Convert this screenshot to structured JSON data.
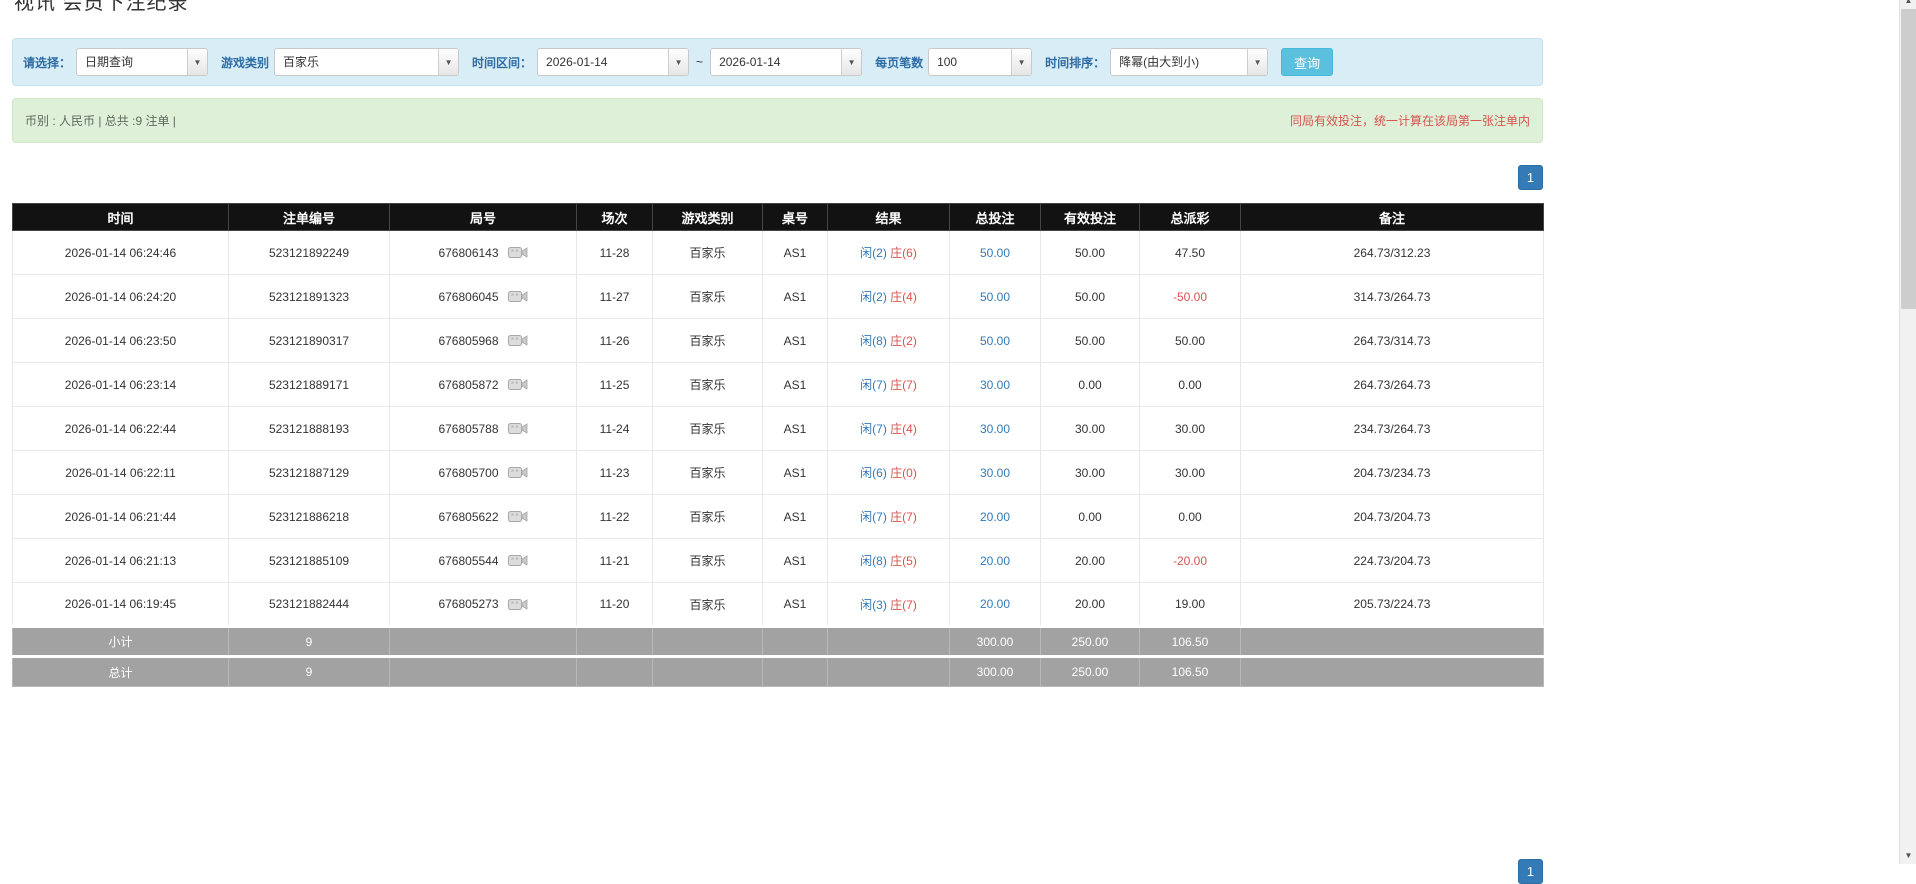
{
  "page": {
    "title": "视讯 会员下注纪录"
  },
  "filters": {
    "select_label": "请选择：",
    "select_value": "日期查询",
    "game_label": "游戏类别",
    "game_value": "百家乐",
    "range_label": "时间区间：",
    "date_from": "2026-01-14",
    "range_separator": "~",
    "date_to": "2026-01-14",
    "page_size_label": "每页笔数",
    "page_size_value": "100",
    "sort_label": "时间排序：",
    "sort_value": "降幂(由大到小)",
    "search_label": "查询"
  },
  "summary": {
    "left": "币别 : 人民币 | 总共 :9 注单 |",
    "right": "同局有效投注，统一计算在该局第一张注单内"
  },
  "pagination": {
    "current_page": "1"
  },
  "table": {
    "headers": [
      "时间",
      "注单编号",
      "局号",
      "场次",
      "游戏类别",
      "桌号",
      "结果",
      "总投注",
      "有效投注",
      "总派彩",
      "备注"
    ],
    "rows": [
      {
        "time": "2026-01-14 06:24:46",
        "bet_id": "523121892249",
        "round_id": "676806143",
        "session": "11-28",
        "game": "百家乐",
        "table_no": "AS1",
        "result_player": "闲(2)",
        "result_banker": "庄(6)",
        "total_bet": "50.00",
        "valid_bet": "50.00",
        "payout": "47.50",
        "note": "264.73/312.23"
      },
      {
        "time": "2026-01-14 06:24:20",
        "bet_id": "523121891323",
        "round_id": "676806045",
        "session": "11-27",
        "game": "百家乐",
        "table_no": "AS1",
        "result_player": "闲(2)",
        "result_banker": "庄(4)",
        "total_bet": "50.00",
        "valid_bet": "50.00",
        "payout": "-50.00",
        "note": "314.73/264.73"
      },
      {
        "time": "2026-01-14 06:23:50",
        "bet_id": "523121890317",
        "round_id": "676805968",
        "session": "11-26",
        "game": "百家乐",
        "table_no": "AS1",
        "result_player": "闲(8)",
        "result_banker": "庄(2)",
        "total_bet": "50.00",
        "valid_bet": "50.00",
        "payout": "50.00",
        "note": "264.73/314.73"
      },
      {
        "time": "2026-01-14 06:23:14",
        "bet_id": "523121889171",
        "round_id": "676805872",
        "session": "11-25",
        "game": "百家乐",
        "table_no": "AS1",
        "result_player": "闲(7)",
        "result_banker": "庄(7)",
        "total_bet": "30.00",
        "valid_bet": "0.00",
        "payout": "0.00",
        "note": "264.73/264.73"
      },
      {
        "time": "2026-01-14 06:22:44",
        "bet_id": "523121888193",
        "round_id": "676805788",
        "session": "11-24",
        "game": "百家乐",
        "table_no": "AS1",
        "result_player": "闲(7)",
        "result_banker": "庄(4)",
        "total_bet": "30.00",
        "valid_bet": "30.00",
        "payout": "30.00",
        "note": "234.73/264.73"
      },
      {
        "time": "2026-01-14 06:22:11",
        "bet_id": "523121887129",
        "round_id": "676805700",
        "session": "11-23",
        "game": "百家乐",
        "table_no": "AS1",
        "result_player": "闲(6)",
        "result_banker": "庄(0)",
        "total_bet": "30.00",
        "valid_bet": "30.00",
        "payout": "30.00",
        "note": "204.73/234.73"
      },
      {
        "time": "2026-01-14 06:21:44",
        "bet_id": "523121886218",
        "round_id": "676805622",
        "session": "11-22",
        "game": "百家乐",
        "table_no": "AS1",
        "result_player": "闲(7)",
        "result_banker": "庄(7)",
        "total_bet": "20.00",
        "valid_bet": "0.00",
        "payout": "0.00",
        "note": "204.73/204.73"
      },
      {
        "time": "2026-01-14 06:21:13",
        "bet_id": "523121885109",
        "round_id": "676805544",
        "session": "11-21",
        "game": "百家乐",
        "table_no": "AS1",
        "result_player": "闲(8)",
        "result_banker": "庄(5)",
        "total_bet": "20.00",
        "valid_bet": "20.00",
        "payout": "-20.00",
        "note": "224.73/204.73"
      },
      {
        "time": "2026-01-14 06:19:45",
        "bet_id": "523121882444",
        "round_id": "676805273",
        "session": "11-20",
        "game": "百家乐",
        "table_no": "AS1",
        "result_player": "闲(3)",
        "result_banker": "庄(7)",
        "total_bet": "20.00",
        "valid_bet": "20.00",
        "payout": "19.00",
        "note": "205.73/224.73"
      }
    ],
    "subtotal": {
      "label": "小计",
      "count": "9",
      "total_bet": "300.00",
      "valid_bet": "250.00",
      "payout": "106.50"
    },
    "total": {
      "label": "总计",
      "count": "9",
      "total_bet": "300.00",
      "valid_bet": "250.00",
      "payout": "106.50"
    }
  }
}
